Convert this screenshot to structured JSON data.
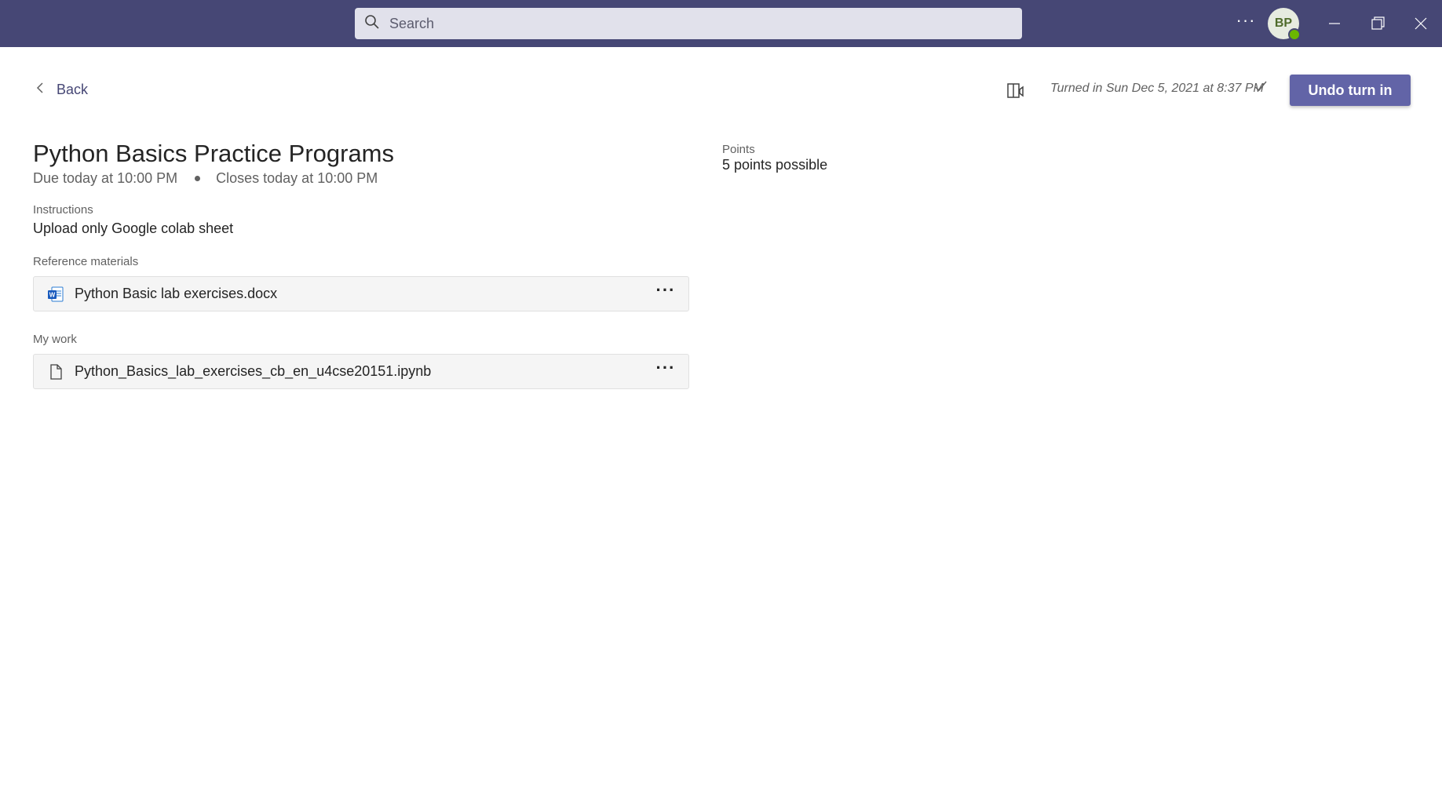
{
  "topbar": {
    "search_placeholder": "Search",
    "more_label": "···",
    "avatar_initials": "BP"
  },
  "nav": {
    "back_label": "Back"
  },
  "status": {
    "turned_in_text": "Turned in Sun Dec 5, 2021 at 8:37 PM",
    "undo_label": "Undo turn in"
  },
  "assignment": {
    "title": "Python Basics Practice Programs",
    "due": "Due today at 10:00 PM",
    "closes": "Closes today at 10:00 PM",
    "instructions_label": "Instructions",
    "instructions_text": "Upload only Google colab sheet",
    "points_label": "Points",
    "points_value": "5 points possible"
  },
  "reference": {
    "label": "Reference materials",
    "files": [
      {
        "name": "Python Basic lab exercises.docx",
        "icon": "word-doc-icon"
      }
    ]
  },
  "my_work": {
    "label": "My work",
    "files": [
      {
        "name": "Python_Basics_lab_exercises_cb_en_u4cse20151.ipynb",
        "icon": "generic-file-icon"
      }
    ]
  },
  "colors": {
    "titlebar": "#464775",
    "accent": "#6264a7",
    "presence": "#6bb700"
  },
  "card_more_label": "···"
}
